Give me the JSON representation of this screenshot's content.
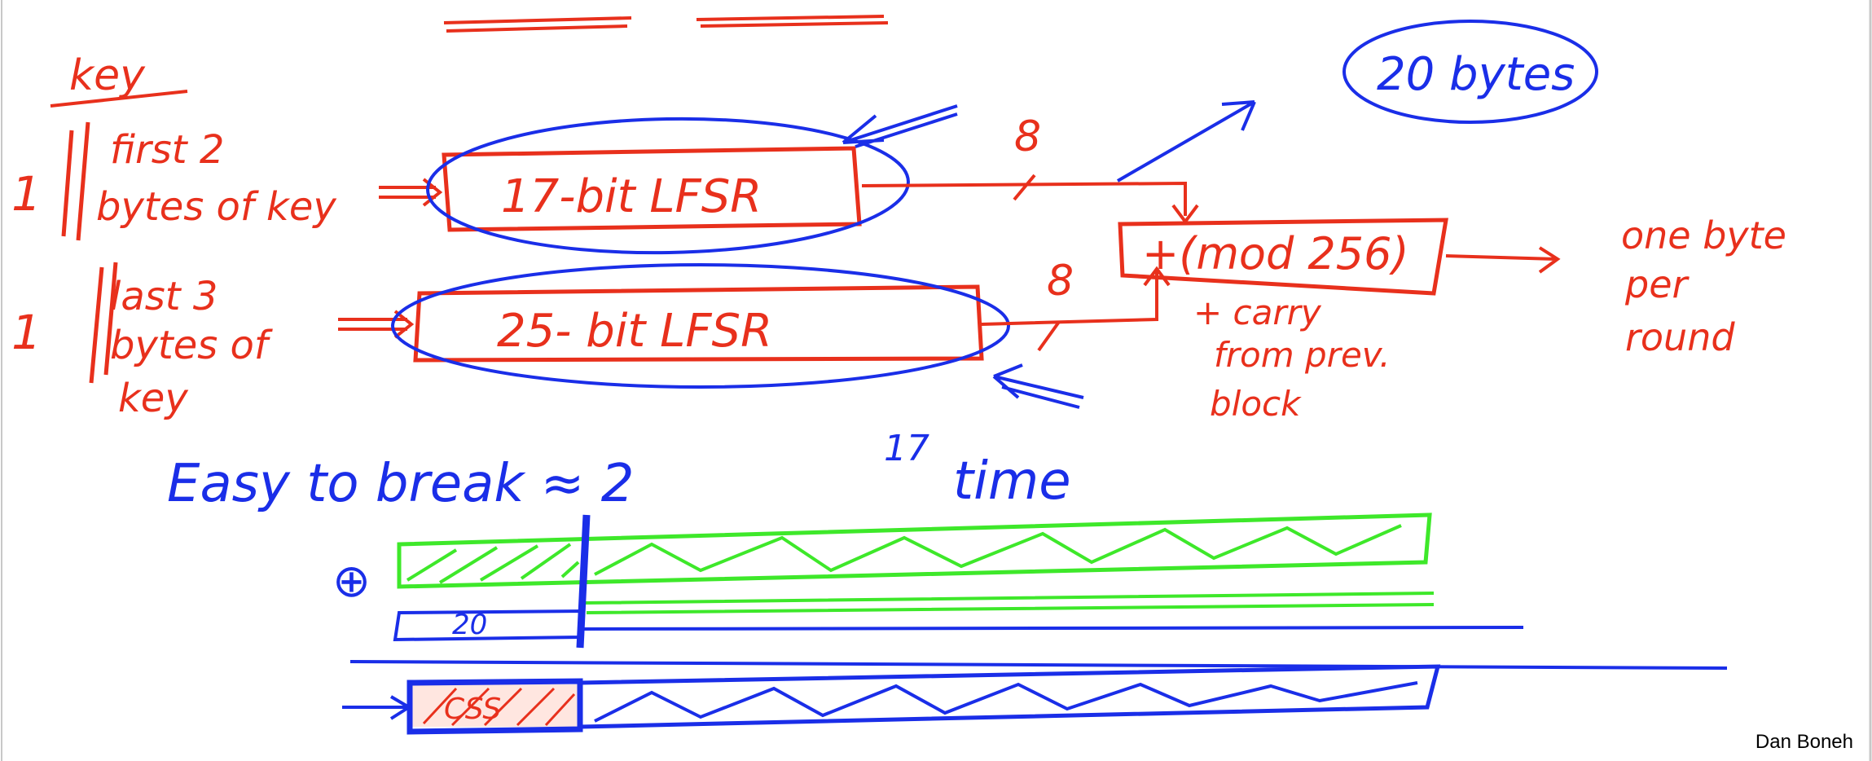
{
  "colors": {
    "red": "#e8301c",
    "blue": "#1a2ee8",
    "green": "#3ee82a",
    "black": "#000000"
  },
  "labels": {
    "key": "key",
    "one_a": "1",
    "one_b": "1",
    "first_2": "first 2",
    "bytes_of_key": "bytes of key",
    "last_3": "last 3",
    "bytes_of": "bytes of",
    "key2": "key",
    "lfsr17": "17-bit LFSR",
    "lfsr25": "25- bit LFSR",
    "eight_a": "8",
    "eight_b": "8",
    "adder": "+(mod 256)",
    "carry1": "+ carry",
    "carry2": "from prev.",
    "carry3": "block",
    "bytes20": "20 bytes",
    "out1": "one byte",
    "out2": "per",
    "out3": "round",
    "easy": "Easy to break ≈ 2",
    "exp": "17",
    "time": "time",
    "twenty": "20",
    "css": "CSS",
    "xor": "⊕",
    "author": "Dan Boneh"
  }
}
